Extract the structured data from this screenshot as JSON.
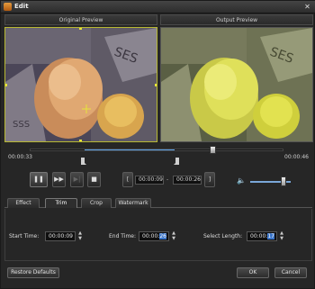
{
  "window": {
    "title": "Edit",
    "close_glyph": "✕"
  },
  "preview": {
    "original_label": "Original Preview",
    "output_label": "Output Preview"
  },
  "timeline": {
    "current_time": "00:00:33",
    "total_time": "00:00:46"
  },
  "playback": {
    "pause_glyph": "❚❚",
    "ff_glyph": "▶▶",
    "skip_glyph": "▶|",
    "stop_glyph": "■",
    "mark_start_glyph": "[",
    "mark_end_glyph": "]",
    "clip_start": "00:00:09",
    "clip_end": "00:00:26",
    "separator": "-",
    "volume_glyph": "🔈"
  },
  "tabs": [
    {
      "label": "Effect"
    },
    {
      "label": "Trim"
    },
    {
      "label": "Crop"
    },
    {
      "label": "Watermark"
    }
  ],
  "trim": {
    "start_label": "Start Time:",
    "start_value": "00:00:09",
    "end_label": "End Time:",
    "end_value_prefix": "00:00:",
    "end_value_selected": "26",
    "length_label": "Select Length:",
    "length_value_prefix": "00:00:",
    "length_value_selected": "17",
    "spin_up": "▲",
    "spin_down": "▼"
  },
  "footer": {
    "restore_label": "Restore Defaults",
    "ok_label": "OK",
    "cancel_label": "Cancel"
  }
}
